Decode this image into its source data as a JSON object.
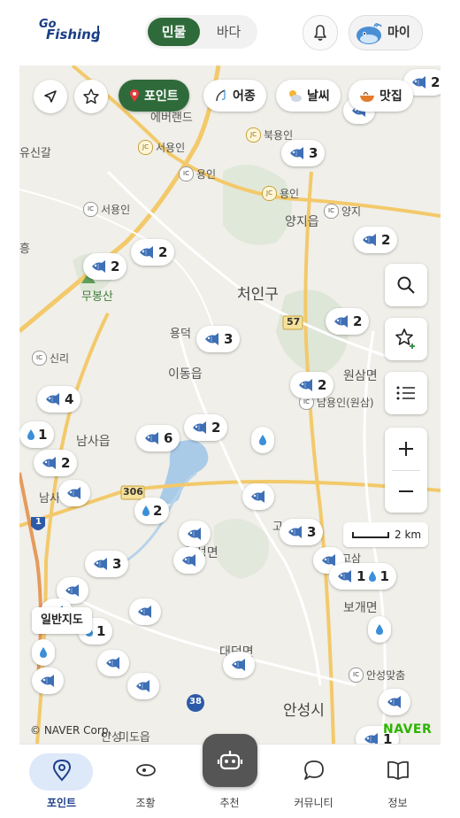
{
  "header": {
    "logo_top": "Go",
    "logo_bottom": "Fishing",
    "segment": {
      "active": "민물",
      "inactive": "바다"
    },
    "my_label": "마이"
  },
  "filters": {
    "point": "포인트",
    "fish_type": "어종",
    "weather": "날씨",
    "food": "맛집"
  },
  "map": {
    "places": [
      {
        "name": "처인구",
        "big": true
      },
      {
        "name": "양지읍"
      },
      {
        "name": "이동읍"
      },
      {
        "name": "남사읍"
      },
      {
        "name": "원삼면"
      },
      {
        "name": "안성시",
        "big": true
      },
      {
        "name": "보개면"
      },
      {
        "name": "대덕면"
      },
      {
        "name": "양성면"
      },
      {
        "name": "고삼"
      },
      {
        "name": "무봉산"
      },
      {
        "name": "용덕"
      },
      {
        "name": "유신갈"
      },
      {
        "name": "에버랜드"
      },
      {
        "name": "흥"
      },
      {
        "name": "남사"
      },
      {
        "name": "안성"
      },
      {
        "name": "고"
      },
      {
        "name": "미도읍"
      }
    ],
    "interchanges": [
      {
        "type": "JC",
        "name": "서용인"
      },
      {
        "type": "JC",
        "name": "북용인"
      },
      {
        "type": "JC",
        "name": "용인"
      },
      {
        "type": "IC",
        "name": "용인"
      },
      {
        "type": "IC",
        "name": "양지"
      },
      {
        "type": "IC",
        "name": "서용인"
      },
      {
        "type": "IC",
        "name": "신리"
      },
      {
        "type": "IC",
        "name": "남용인(원삼)"
      },
      {
        "type": "IC",
        "name": "안성맞춤"
      }
    ],
    "road_labels": [
      "57",
      "306",
      "1",
      "38"
    ],
    "markers": [
      {
        "kind": "fish",
        "count": "2"
      },
      {
        "kind": "fish",
        "count": "3"
      },
      {
        "kind": "fish",
        "count": ""
      },
      {
        "kind": "fish",
        "count": "2"
      },
      {
        "kind": "fish",
        "count": "2"
      },
      {
        "kind": "fish",
        "count": "2"
      },
      {
        "kind": "fish",
        "count": "2"
      },
      {
        "kind": "fish",
        "count": "3"
      },
      {
        "kind": "fish",
        "count": "4"
      },
      {
        "kind": "fish",
        "count": "2"
      },
      {
        "kind": "drop",
        "count": "1"
      },
      {
        "kind": "fish",
        "count": "6"
      },
      {
        "kind": "fish",
        "count": "2"
      },
      {
        "kind": "drop",
        "count": ""
      },
      {
        "kind": "fish",
        "count": "2"
      },
      {
        "kind": "fish",
        "count": ""
      },
      {
        "kind": "fish",
        "count": ""
      },
      {
        "kind": "drop",
        "count": "2"
      },
      {
        "kind": "fish",
        "count": ""
      },
      {
        "kind": "fish",
        "count": "3"
      },
      {
        "kind": "fish",
        "count": ""
      },
      {
        "kind": "fish",
        "count": "3"
      },
      {
        "kind": "fish",
        "count": ""
      },
      {
        "kind": "fish",
        "count": ""
      },
      {
        "kind": "fish+drop",
        "count": "1",
        "count2": "1"
      },
      {
        "kind": "fish",
        "count": ""
      },
      {
        "kind": "fish",
        "count": ""
      },
      {
        "kind": "drop",
        "count": "1"
      },
      {
        "kind": "drop",
        "count": ""
      },
      {
        "kind": "drop",
        "count": ""
      },
      {
        "kind": "fish",
        "count": ""
      },
      {
        "kind": "fish",
        "count": ""
      },
      {
        "kind": "fish",
        "count": ""
      },
      {
        "kind": "fish",
        "count": ""
      },
      {
        "kind": "fish",
        "count": ""
      },
      {
        "kind": "fish",
        "count": "1"
      }
    ],
    "scale_label": "2 km",
    "map_type_label": "일반지도",
    "copyright": "© NAVER Corp.",
    "naver_logo": "NAVER"
  },
  "nav": {
    "tabs": [
      {
        "label": "포인트",
        "active": true
      },
      {
        "label": "조황"
      },
      {
        "label": "추천"
      },
      {
        "label": "커뮤니티"
      },
      {
        "label": "정보"
      }
    ]
  },
  "colors": {
    "accent_green": "#2f6b3a",
    "nav_active_bg": "#dde8f8",
    "nav_active_text": "#1d3f8a",
    "fish_blue": "#3f6fb5",
    "drop_blue": "#3b8fd9"
  }
}
